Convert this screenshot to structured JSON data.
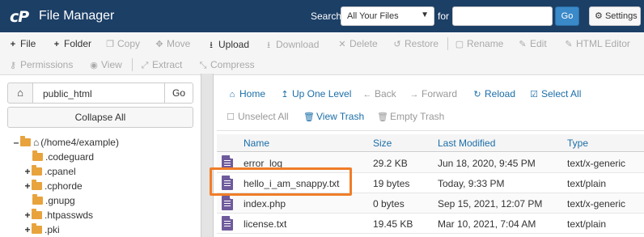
{
  "header": {
    "logo": "cP",
    "title": "File Manager",
    "search_label": "Search",
    "search_scope": "All Your Files",
    "for_label": "for",
    "search_value": "",
    "go_label": "Go",
    "settings_label": "Settings"
  },
  "toolbar": {
    "file": "File",
    "folder": "Folder",
    "copy": "Copy",
    "move": "Move",
    "upload": "Upload",
    "download": "Download",
    "delete": "Delete",
    "restore": "Restore",
    "rename": "Rename",
    "edit": "Edit",
    "html_editor": "HTML Editor",
    "permissions": "Permissions",
    "view": "View",
    "extract": "Extract",
    "compress": "Compress"
  },
  "left_pane": {
    "path_value": "public_html",
    "go_label": "Go",
    "collapse_label": "Collapse All",
    "tree": [
      {
        "label": "(/home4/example)"
      },
      {
        "label": ".codeguard"
      },
      {
        "label": ".cpanel"
      },
      {
        "label": ".cphorde"
      },
      {
        "label": ".gnupg"
      },
      {
        "label": ".htpasswds"
      },
      {
        "label": ".pki"
      }
    ]
  },
  "right_pane": {
    "nav": {
      "home": "Home",
      "up_one_level": "Up One Level",
      "back": "Back",
      "forward": "Forward",
      "reload": "Reload",
      "select_all": "Select All",
      "unselect_all": "Unselect All",
      "view_trash": "View Trash",
      "empty_trash": "Empty Trash"
    },
    "columns": {
      "name": "Name",
      "size": "Size",
      "last_modified": "Last Modified",
      "type": "Type"
    },
    "files": [
      {
        "name": "error_log_",
        "size": "29.2 KB",
        "modified": "Jun 18, 2020, 9:45 PM",
        "type": "text/x-generic"
      },
      {
        "name": "hello_i_am_snappy.txt",
        "size": "19 bytes",
        "modified": "Today, 9:33 PM",
        "type": "text/plain"
      },
      {
        "name": "index.php",
        "size": "0 bytes",
        "modified": "Sep 15, 2021, 12:07 PM",
        "type": "text/x-generic"
      },
      {
        "name": "license.txt",
        "size": "19.45 KB",
        "modified": "Mar 10, 2021, 7:04 AM",
        "type": "text/plain"
      }
    ]
  },
  "colors": {
    "header_bg": "#1c3f66",
    "link_blue": "#1b6ea8",
    "go_button": "#3a89c9",
    "highlight_border": "#f07d28",
    "folder": "#e8a33d",
    "file_icon": "#6f5a9c"
  }
}
